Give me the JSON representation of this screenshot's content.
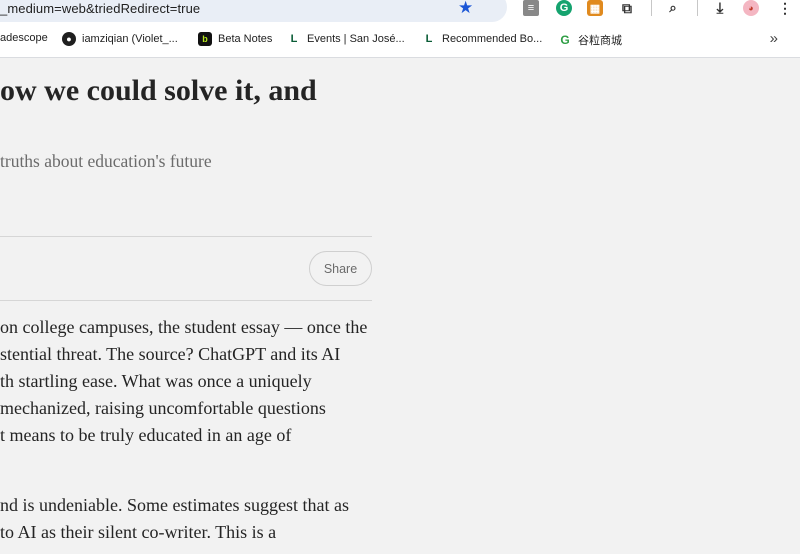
{
  "browser": {
    "url": "_medium=web&triedRedirect=true"
  },
  "bookmarks": {
    "items": [
      {
        "label": "adescope",
        "icon": "none"
      },
      {
        "label": "iamziqian (Violet_...",
        "icon": "github-icon"
      },
      {
        "label": "Beta Notes",
        "icon": "beta-notes-icon"
      },
      {
        "label": "Events | San José...",
        "icon": "sjsu-icon"
      },
      {
        "label": "Recommended Bo...",
        "icon": "sjsu-icon"
      },
      {
        "label": "谷粒商城",
        "icon": "gulimall-icon"
      }
    ],
    "more_label": "»"
  },
  "article": {
    "title": "ow we could solve it, and",
    "subtitle": "truths about education's future",
    "share_label": "Share",
    "paragraph1": [
      "on college campuses, the student essay — once the",
      "stential threat. The source? ChatGPT and its AI",
      "th startling ease. What was once a uniquely",
      " mechanized, raising uncomfortable questions",
      "t means to be truly educated in an age of"
    ],
    "paragraph2": [
      "nd is undeniable. Some estimates suggest that as",
      " to AI as their silent co-writer. This is a"
    ]
  },
  "colors": {
    "page_bg": "#f2f2f2",
    "omnibox_bg": "#e9eef6",
    "star": "#1a55d6",
    "title_text": "#242424",
    "subtitle_text": "#6b6b6b"
  }
}
